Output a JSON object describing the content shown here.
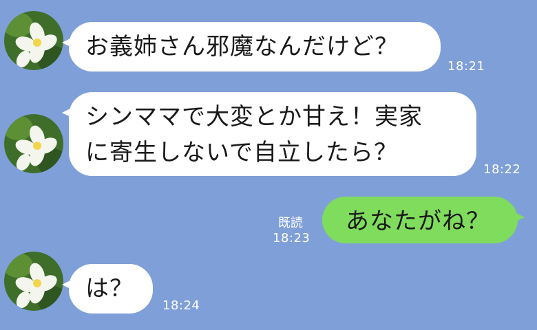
{
  "chat": {
    "background_color": "#7f9fd8",
    "messages": [
      {
        "sender": "other",
        "text": "お義姉さん邪魔なんだけど？",
        "time": "18:21"
      },
      {
        "sender": "other",
        "line1": "シンママで大変とか甘え！実家",
        "line2": "に寄生しないで自立したら？",
        "time": "18:22"
      },
      {
        "sender": "self",
        "text": "あなたがね？",
        "time": "18:23",
        "read_label": "既読"
      },
      {
        "sender": "other",
        "text": "は？",
        "time": "18:24"
      }
    ]
  },
  "colors": {
    "incoming_bubble": "#ffffff",
    "outgoing_bubble": "#80dc5c",
    "timestamp": "#ffffff"
  },
  "icons": {
    "avatar": "avatar-flower-icon"
  }
}
